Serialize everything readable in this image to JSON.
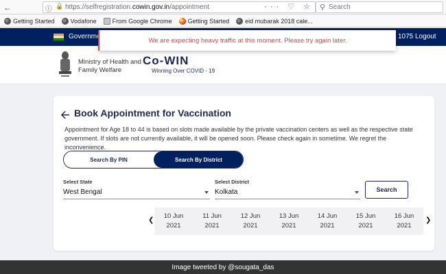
{
  "browser": {
    "url_prefix": "https://selfregistration.",
    "url_domain": "cowin.gov.in",
    "url_path": "/appointment",
    "url_actions": "··· ♡ ☆",
    "search_placeholder": "Search"
  },
  "bookmarks": [
    {
      "label": "Getting Started",
      "icon": "globe-icon"
    },
    {
      "label": "Vodafone",
      "icon": "globe-icon"
    },
    {
      "label": "From Google Chrome",
      "icon": "folder-icon"
    },
    {
      "label": "Getting Started",
      "icon": "firefox-icon"
    },
    {
      "label": "eid mubarak 2018 cale...",
      "icon": "globe-icon"
    }
  ],
  "header": {
    "gov_text": "Government",
    "user_number": "1075",
    "logout_label": "Logout"
  },
  "brand": {
    "ministry_line1": "Ministry of Health and",
    "ministry_line2": "Family Welfare",
    "app_name": "Co-WIN",
    "tagline": "Winning Over COVID - 19"
  },
  "alert": {
    "message": "We are expecting heavy traffic at this moment. Please try again later."
  },
  "booking": {
    "title": "Book Appointment for Vaccination",
    "description": "Appointment for Age 18 to 44 is based on slots made available by the private vaccination centers as well as the respective state government. If slots are not currently available, it will be opened soon. Please check again in sometime. We regret the inconvenience.",
    "tab_pin": "Search By PIN",
    "tab_district": "Search By District",
    "state_label": "Select State",
    "state_value": "West Bengal",
    "district_label": "Select District",
    "district_value": "Kolkata",
    "search_label": "Search"
  },
  "dates": [
    {
      "day": "10 Jun",
      "year": "2021"
    },
    {
      "day": "11 Jun",
      "year": "2021"
    },
    {
      "day": "12 Jun",
      "year": "2021"
    },
    {
      "day": "13 Jun",
      "year": "2021"
    },
    {
      "day": "14 Jun",
      "year": "2021"
    },
    {
      "day": "15 Jun",
      "year": "2021"
    },
    {
      "day": "16 Jun",
      "year": "2021"
    }
  ],
  "credit": "Image tweeted by @sougata_das",
  "colors": {
    "navy": "#002060",
    "brand_text": "#1d2750",
    "alert_red": "#d94343"
  }
}
